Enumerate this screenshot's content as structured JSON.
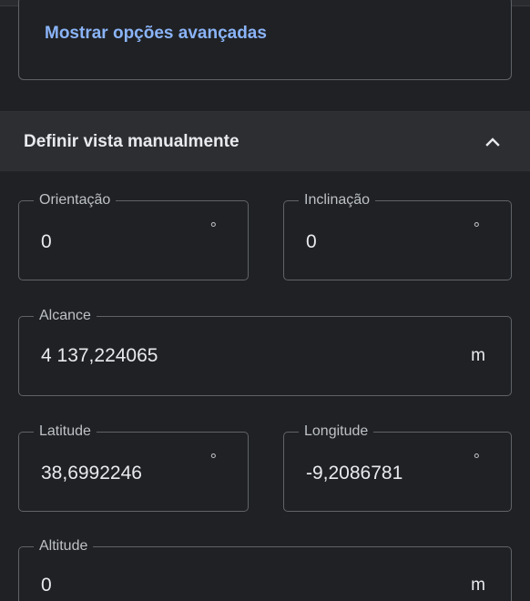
{
  "advanced": {
    "link_label": "Mostrar opções avançadas"
  },
  "section": {
    "title": "Definir vista manualmente",
    "chevron_icon": "chevron-up-icon"
  },
  "fields": {
    "orientation": {
      "label": "Orientação",
      "value": "0",
      "unit": "°"
    },
    "tilt": {
      "label": "Inclinação",
      "value": "0",
      "unit": "°"
    },
    "range": {
      "label": "Alcance",
      "value": "4 137,224065",
      "unit": "m"
    },
    "latitude": {
      "label": "Latitude",
      "value": "38,6992246",
      "unit": "°"
    },
    "longitude": {
      "label": "Longitude",
      "value": "-9,2086781",
      "unit": "°"
    },
    "altitude": {
      "label": "Altitude",
      "value": "0",
      "unit": "m"
    }
  },
  "colors": {
    "background": "#202124",
    "header_background": "#2d2e31",
    "link": "#8ab4f8",
    "border": "#5f6368",
    "text": "#e8eaed"
  }
}
